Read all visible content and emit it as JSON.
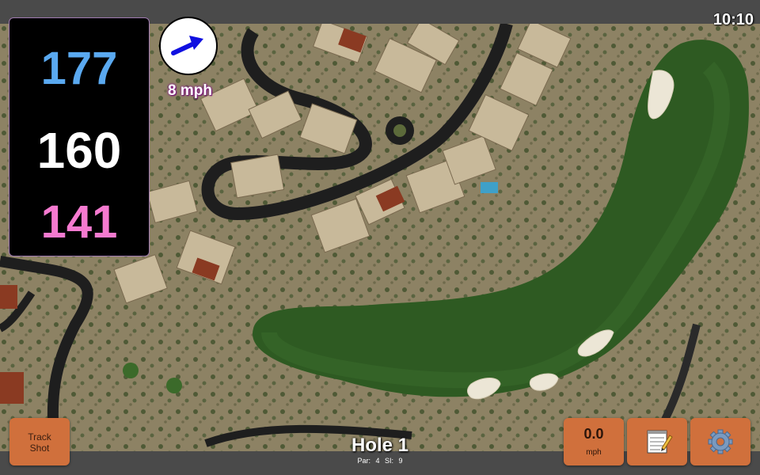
{
  "clock": "10:10",
  "yardages": {
    "back": "177",
    "middle": "160",
    "front": "141"
  },
  "wind": {
    "speed": "8 mph",
    "direction_icon": "arrow-icon"
  },
  "buttons": {
    "track_shot": "Track\nShot",
    "track_shot_line1": "Track",
    "track_shot_line2": "Shot"
  },
  "speed": {
    "value": "0.0",
    "unit": "mph"
  },
  "hole": {
    "title": "Hole 1",
    "par_label": "Par: 4",
    "si_label": "SI: 9"
  },
  "icons": {
    "notes": "notepad-icon",
    "settings": "gear-icon"
  },
  "colors": {
    "back_yardage": "#5aa9f0",
    "middle_yardage": "#ffffff",
    "front_yardage": "#f57ad0",
    "button": "#d0703c"
  }
}
